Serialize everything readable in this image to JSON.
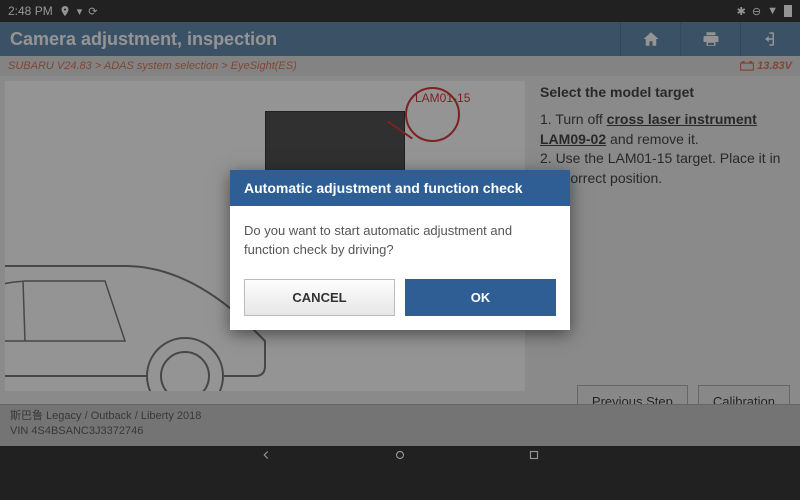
{
  "statusbar": {
    "time": "2:48 PM"
  },
  "header": {
    "title": "Camera adjustment, inspection"
  },
  "breadcrumb": {
    "path": "SUBARU V24.83 > ADAS system selection > EyeSight(ES)",
    "voltage": "13.83V"
  },
  "instructions": {
    "title": "Select the model target",
    "line1a": "1. Turn off ",
    "line1b": "cross laser instrument LAM09-02",
    "line1c": " and remove it.",
    "line2": "2. Use the LAM01-15 target. Place it in the correct position."
  },
  "diagram": {
    "label": "LAM01-15"
  },
  "actions": {
    "prev": "Previous Step",
    "calib": "Calibration"
  },
  "footer": {
    "model": "斯巴鲁 Legacy / Outback / Liberty 2018",
    "vin": "VIN 4S4BSANC3J3372746"
  },
  "dialog": {
    "title": "Automatic adjustment and function check",
    "body": "Do you want to start automatic adjustment and function check by driving?",
    "cancel": "CANCEL",
    "ok": "OK"
  }
}
